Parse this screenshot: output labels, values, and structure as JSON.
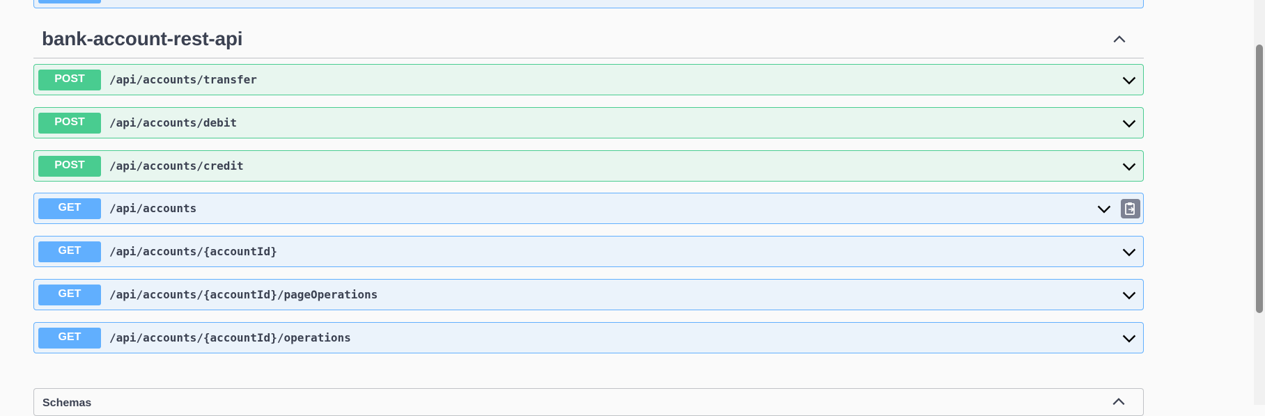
{
  "section": {
    "title": "bank-account-rest-api"
  },
  "operations": [
    {
      "method": "POST",
      "path": "/api/accounts/transfer"
    },
    {
      "method": "POST",
      "path": "/api/accounts/debit"
    },
    {
      "method": "POST",
      "path": "/api/accounts/credit"
    },
    {
      "method": "GET",
      "path": "/api/accounts"
    },
    {
      "method": "GET",
      "path": "/api/accounts/{accountId}"
    },
    {
      "method": "GET",
      "path": "/api/accounts/{accountId}/pageOperations"
    },
    {
      "method": "GET",
      "path": "/api/accounts/{accountId}/operations"
    }
  ],
  "schemas": {
    "title": "Schemas"
  },
  "icons": {
    "section_toggle": "chevron-up-icon",
    "operation_toggle": "chevron-down-icon",
    "copy": "clipboard-icon"
  },
  "colors": {
    "post": "#49cc90",
    "get": "#61affe"
  }
}
